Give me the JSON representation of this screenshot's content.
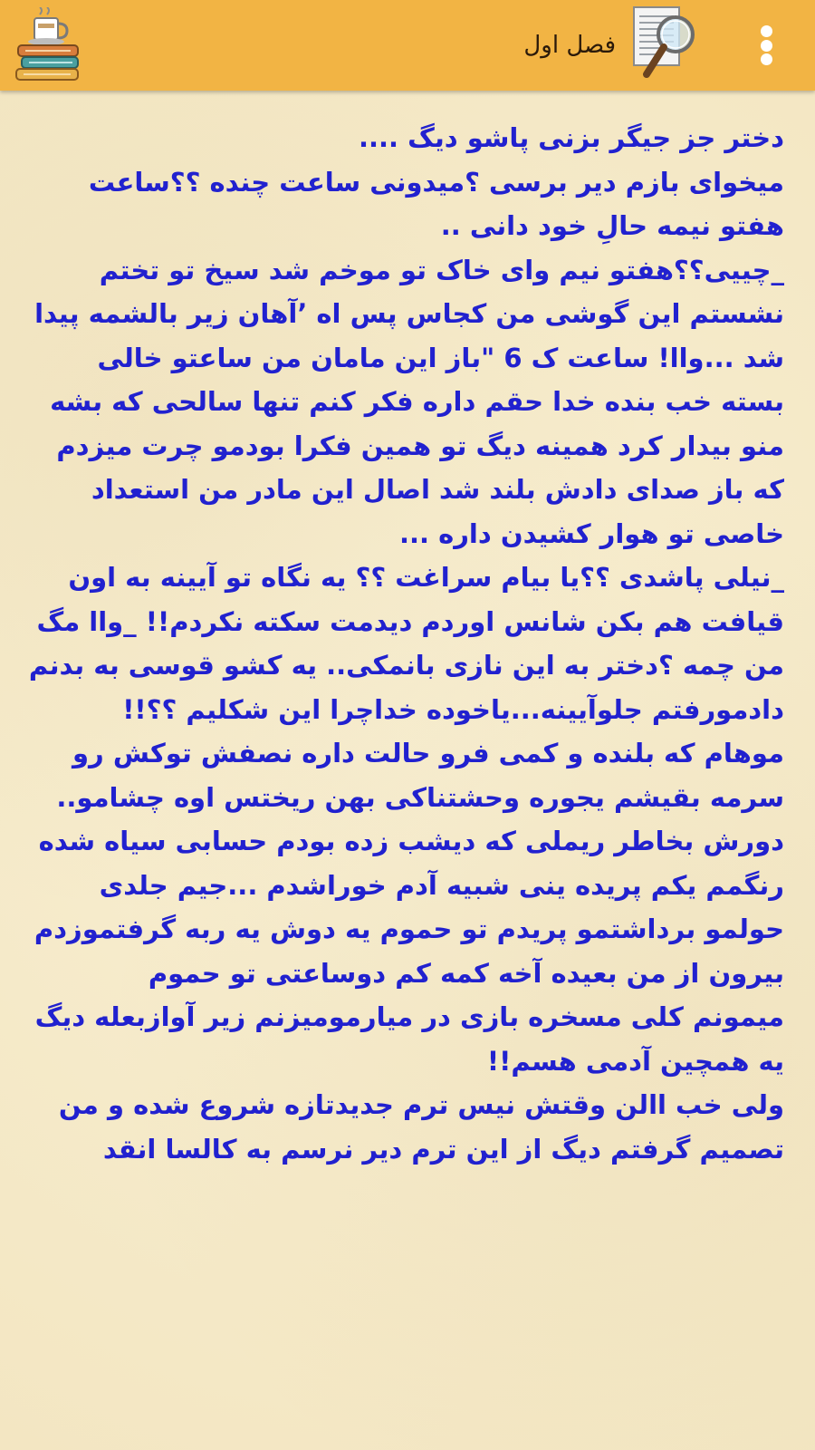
{
  "app_bar": {
    "title": "فصل اول",
    "menu_icon": "more-vertical-icon",
    "document_icon": "document-magnifier-icon",
    "app_icon": "coffee-books-icon",
    "background_color": "#f2b444"
  },
  "content": {
    "text_color": "#2121cf",
    "paragraphs": [
      "دختر جز جیگر بزنی پاشو دیگ ....",
      "میخوای بازم دیر برسی ؟میدونی ساعت چنده ؟؟ساعت هفتو نیمه حالِ خود دانی ..",
      "_چییی؟؟هفتو نیم وای خاک تو موخم شد سیخ تو تختم نشستم این گوشی من کجاس پس اه ’آهان زیر بالشمه پیدا شد ...واا! ساعت ک 6 \"باز این مامان من ساعتو خالی بسته خب بنده خدا حقم داره فکر کنم تنها سالحی که بشه منو بیدار کرد همینه دیگ تو همین فکرا بودمو چرت میزدم که باز صدای دادش بلند شد اصال این مادر من استعداد خاصی تو هوار کشیدن داره ...",
      "_نیلی پاشدی ؟؟یا بیام سراغت ؟؟ یه نگاه تو آیینه به اون قیافت هم بکن شانس اوردم دیدمت سکته نکردم!! _واا مگ من چمه ؟دختر به این نازی بانمکی.. یه کشو قوسی به بدنم دادمورفتم جلوآیینه...یاخوده خداچرا این شکلیم ؟؟!!",
      "موهام که بلنده و کمی فرو حالت داره نصفش توکش رو سرمه بقیشم یجوره وحشتناکی بهن ریختس اوه چشامو..",
      "دورش بخاطر ریملی که دیشب زده بودم حسابی سیاه شده رنگمم یکم پریده ینی شبیه آدم خوراشدم ...جیم جلدی",
      "حولمو برداشتمو پریدم تو حموم یه دوش یه ربه گرفتموزدم بیرون از من بعیده آخه کمه کم دوساعتی تو حموم",
      "میمونم کلی مسخره بازی در میارمومیزنم زیر آوازبعله دیگ یه همچین آدمی هسم!!",
      "ولی خب االن وقتش نیس ترم جدیدتازه شروع شده و من تصمیم گرفتم دیگ از این ترم دیر نرسم به کالسا انقد"
    ]
  }
}
